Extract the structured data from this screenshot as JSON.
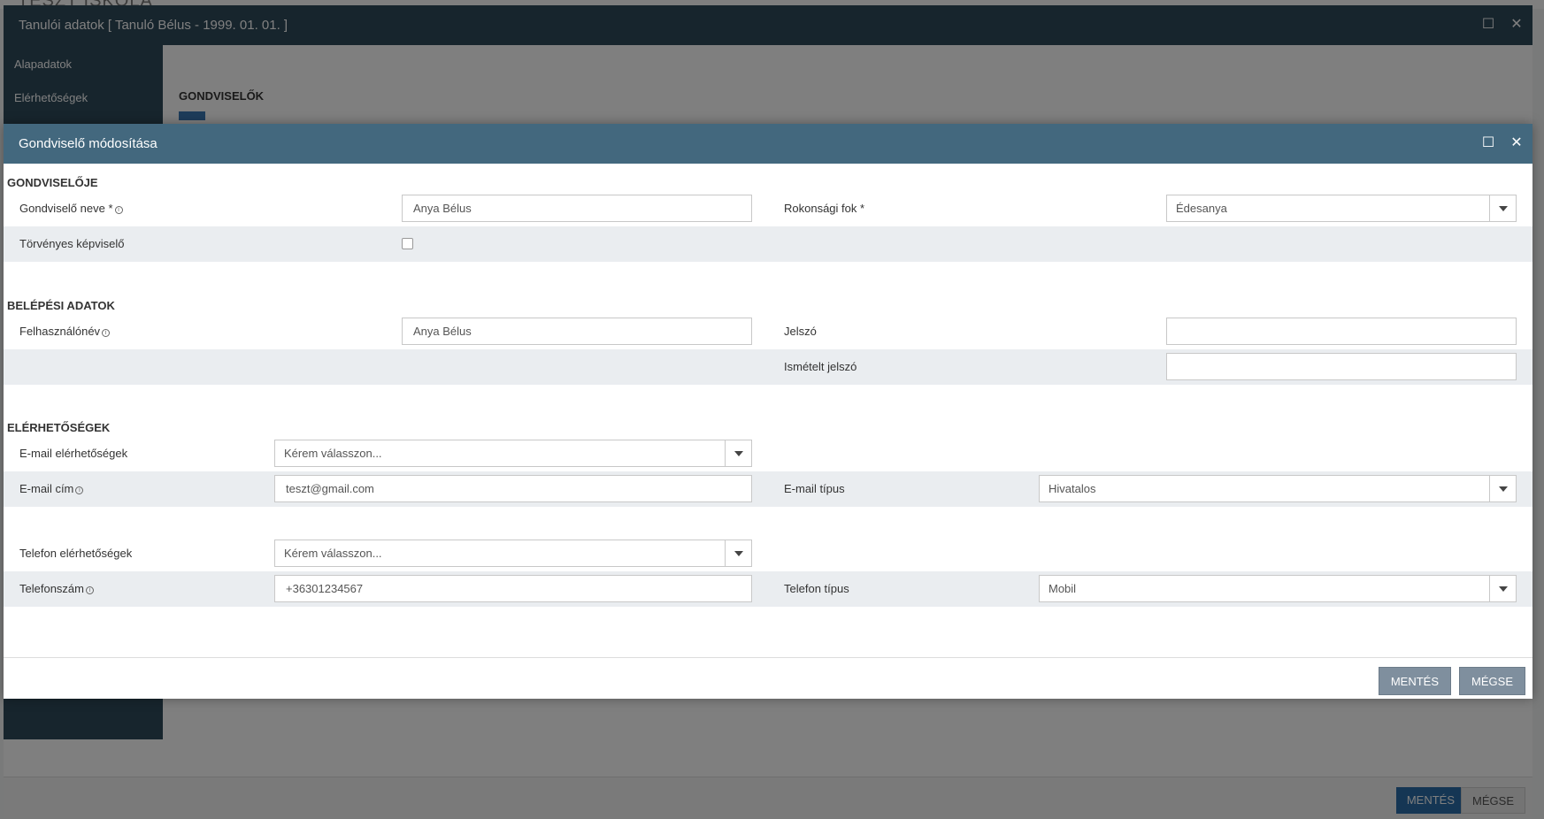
{
  "background": {
    "app_title": "TESZT ISKOLA",
    "window_title": "Tanulói adatok [ Tanuló Bélus - 1999. 01. 01. ]",
    "sidebar": [
      {
        "label": "Alapadatok"
      },
      {
        "label": "Elérhetőségek"
      }
    ],
    "section_title": "GONDVISELŐK",
    "save_label": "MENTÉS",
    "cancel_label": "MÉGSE"
  },
  "modal": {
    "title": "Gondviselő módosítása",
    "sections": {
      "guardian": "GONDVISELŐJE",
      "login": "BELÉPÉSI ADATOK",
      "contacts": "ELÉRHETŐSÉGEK"
    },
    "fields": {
      "guardian_name": {
        "label": "Gondviselő neve *",
        "value": "Anya Bélus"
      },
      "relation": {
        "label": "Rokonsági fok *",
        "value": "Édesanya"
      },
      "legal_rep": {
        "label": "Törvényes képviselő",
        "checked": false
      },
      "username": {
        "label": "Felhasználónév",
        "value": "Anya Bélus"
      },
      "password": {
        "label": "Jelszó",
        "value": ""
      },
      "password_repeat": {
        "label": "Ismételt jelszó",
        "value": ""
      },
      "email_contacts": {
        "label": "E-mail elérhetőségek",
        "value": "Kérem válasszon..."
      },
      "email": {
        "label": "E-mail cím",
        "value": "teszt@gmail.com"
      },
      "email_type": {
        "label": "E-mail típus",
        "value": "Hivatalos"
      },
      "phone_contacts": {
        "label": "Telefon elérhetőségek",
        "value": "Kérem válasszon..."
      },
      "phone": {
        "label": "Telefonszám",
        "value": "+36301234567"
      },
      "phone_type": {
        "label": "Telefon típus",
        "value": "Mobil"
      }
    },
    "save_label": "MENTÉS",
    "cancel_label": "MÉGSE"
  },
  "icons": {
    "maximize": "maximize-icon",
    "close": "close-icon",
    "info": "info-icon",
    "dropdown": "chevron-down-icon"
  }
}
